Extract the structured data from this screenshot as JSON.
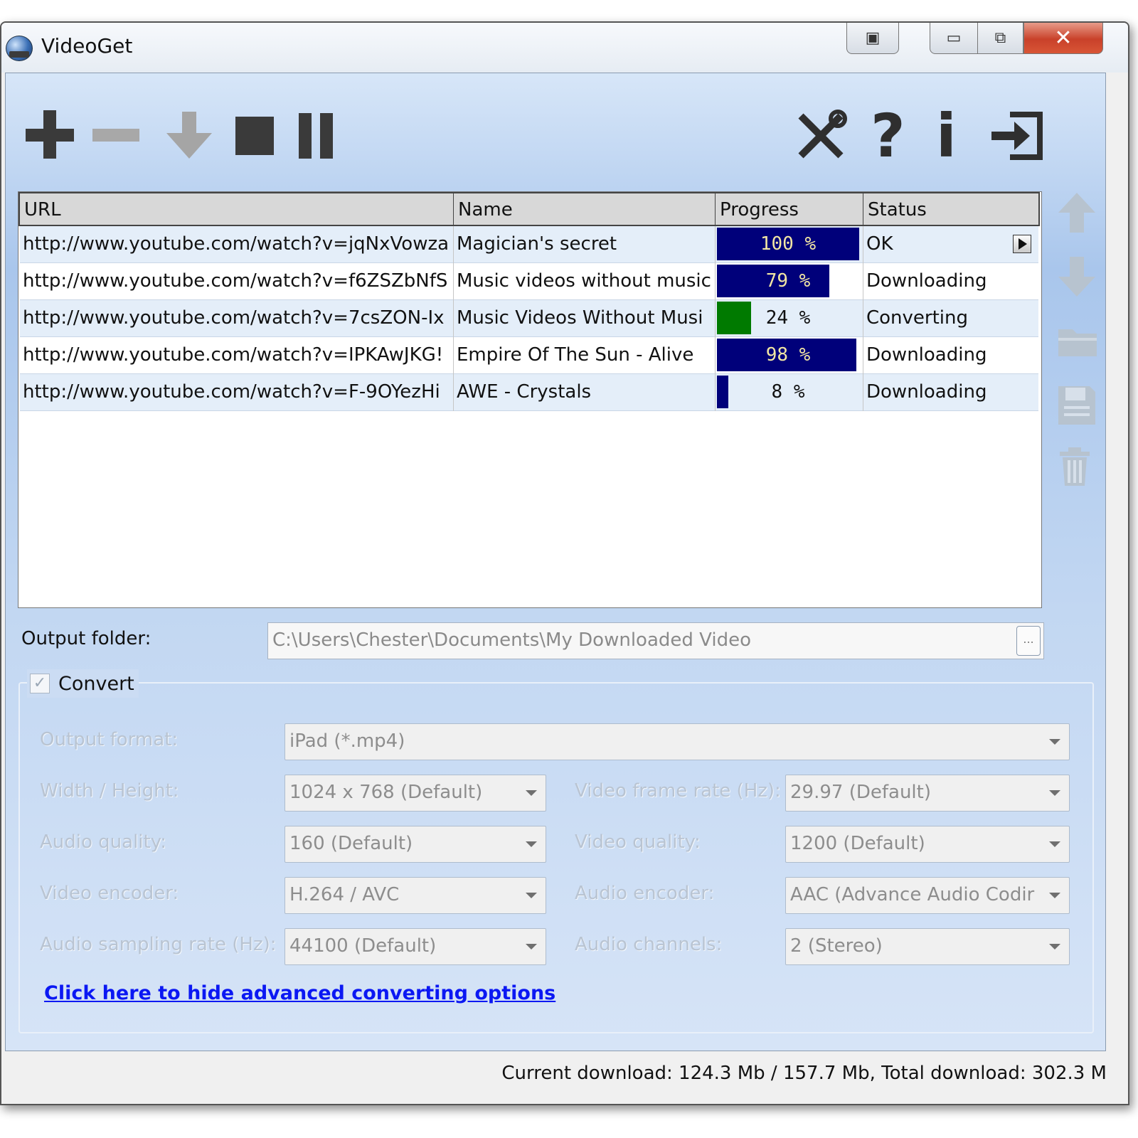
{
  "window": {
    "title": "VideoGet",
    "close_glyph": "✕",
    "minimize_glyph": "▭",
    "maximize_glyph": "⧉",
    "extra_glyph": "▣"
  },
  "toolbar": {
    "left_icons": [
      "plus-icon",
      "minus-icon",
      "download-arrow-icon",
      "stop-icon",
      "pause-icon"
    ],
    "right_icons": [
      {
        "name": "tools-icon",
        "glyph": "✕"
      },
      {
        "name": "help-icon",
        "glyph": "?"
      },
      {
        "name": "info-icon",
        "glyph": "i"
      },
      {
        "name": "exit-icon",
        "glyph": "⇥"
      }
    ]
  },
  "list": {
    "columns": [
      "URL",
      "Name",
      "Progress",
      "Status"
    ],
    "rows": [
      {
        "url": "http://www.youtube.com/watch?v=jqNxVowza",
        "name": "Magician's secret",
        "progress": 100,
        "progress_label": "100 %",
        "status": "OK",
        "has_play": true
      },
      {
        "url": "http://www.youtube.com/watch?v=f6ZSZbNfS",
        "name": "Music videos without music",
        "progress": 79,
        "progress_label": "79 %",
        "status": "Downloading",
        "has_play": false
      },
      {
        "url": "http://www.youtube.com/watch?v=7csZON-Ix",
        "name": "Music Videos Without Musi",
        "progress": 24,
        "progress_label": "24 %",
        "status": "Converting",
        "has_play": false,
        "bar_color": "green"
      },
      {
        "url": "http://www.youtube.com/watch?v=IPKAwJKG!",
        "name": "Empire Of The Sun - Alive",
        "progress": 98,
        "progress_label": "98 %",
        "status": "Downloading",
        "has_play": false
      },
      {
        "url": "http://www.youtube.com/watch?v=F-9OYezHi",
        "name": "AWE - Crystals",
        "progress": 8,
        "progress_label": "8 %",
        "status": "Downloading",
        "has_play": false
      }
    ]
  },
  "side_buttons": [
    "move-up-icon",
    "move-down-icon",
    "folder-icon",
    "save-icon",
    "trash-icon"
  ],
  "output": {
    "label": "Output folder:",
    "value": "C:\\Users\\Chester\\Documents\\My Downloaded Video",
    "browse_label": "..."
  },
  "convert": {
    "label": "Convert",
    "checked": true,
    "check_glyph": "✓",
    "output_format": {
      "label": "Output format:",
      "value": "iPad (*.mp4)"
    },
    "width_height": {
      "label": "Width / Height:",
      "value": "1024 x 768 (Default)"
    },
    "frame_rate": {
      "label": "Video frame rate (Hz):",
      "value": "29.97 (Default)"
    },
    "audio_quality": {
      "label": "Audio quality:",
      "value": "160 (Default)"
    },
    "video_quality": {
      "label": "Video quality:",
      "value": "1200 (Default)"
    },
    "video_encoder": {
      "label": "Video encoder:",
      "value": "H.264 / AVC"
    },
    "audio_encoder": {
      "label": "Audio encoder:",
      "value": "AAC (Advance Audio Codir"
    },
    "sampling_rate": {
      "label": "Audio sampling rate (Hz):",
      "value": "44100 (Default)"
    },
    "audio_channels": {
      "label": "Audio channels:",
      "value": "2 (Stereo)"
    },
    "hide_link": "Click here to hide advanced converting options"
  },
  "status_bar": {
    "text": "Current download: 124.3 Mb / 157.7 Mb,  Total download: 302.3 M"
  },
  "colors": {
    "progress_blue": "#00007a",
    "progress_green": "#007a00",
    "link": "#0b18f3"
  }
}
